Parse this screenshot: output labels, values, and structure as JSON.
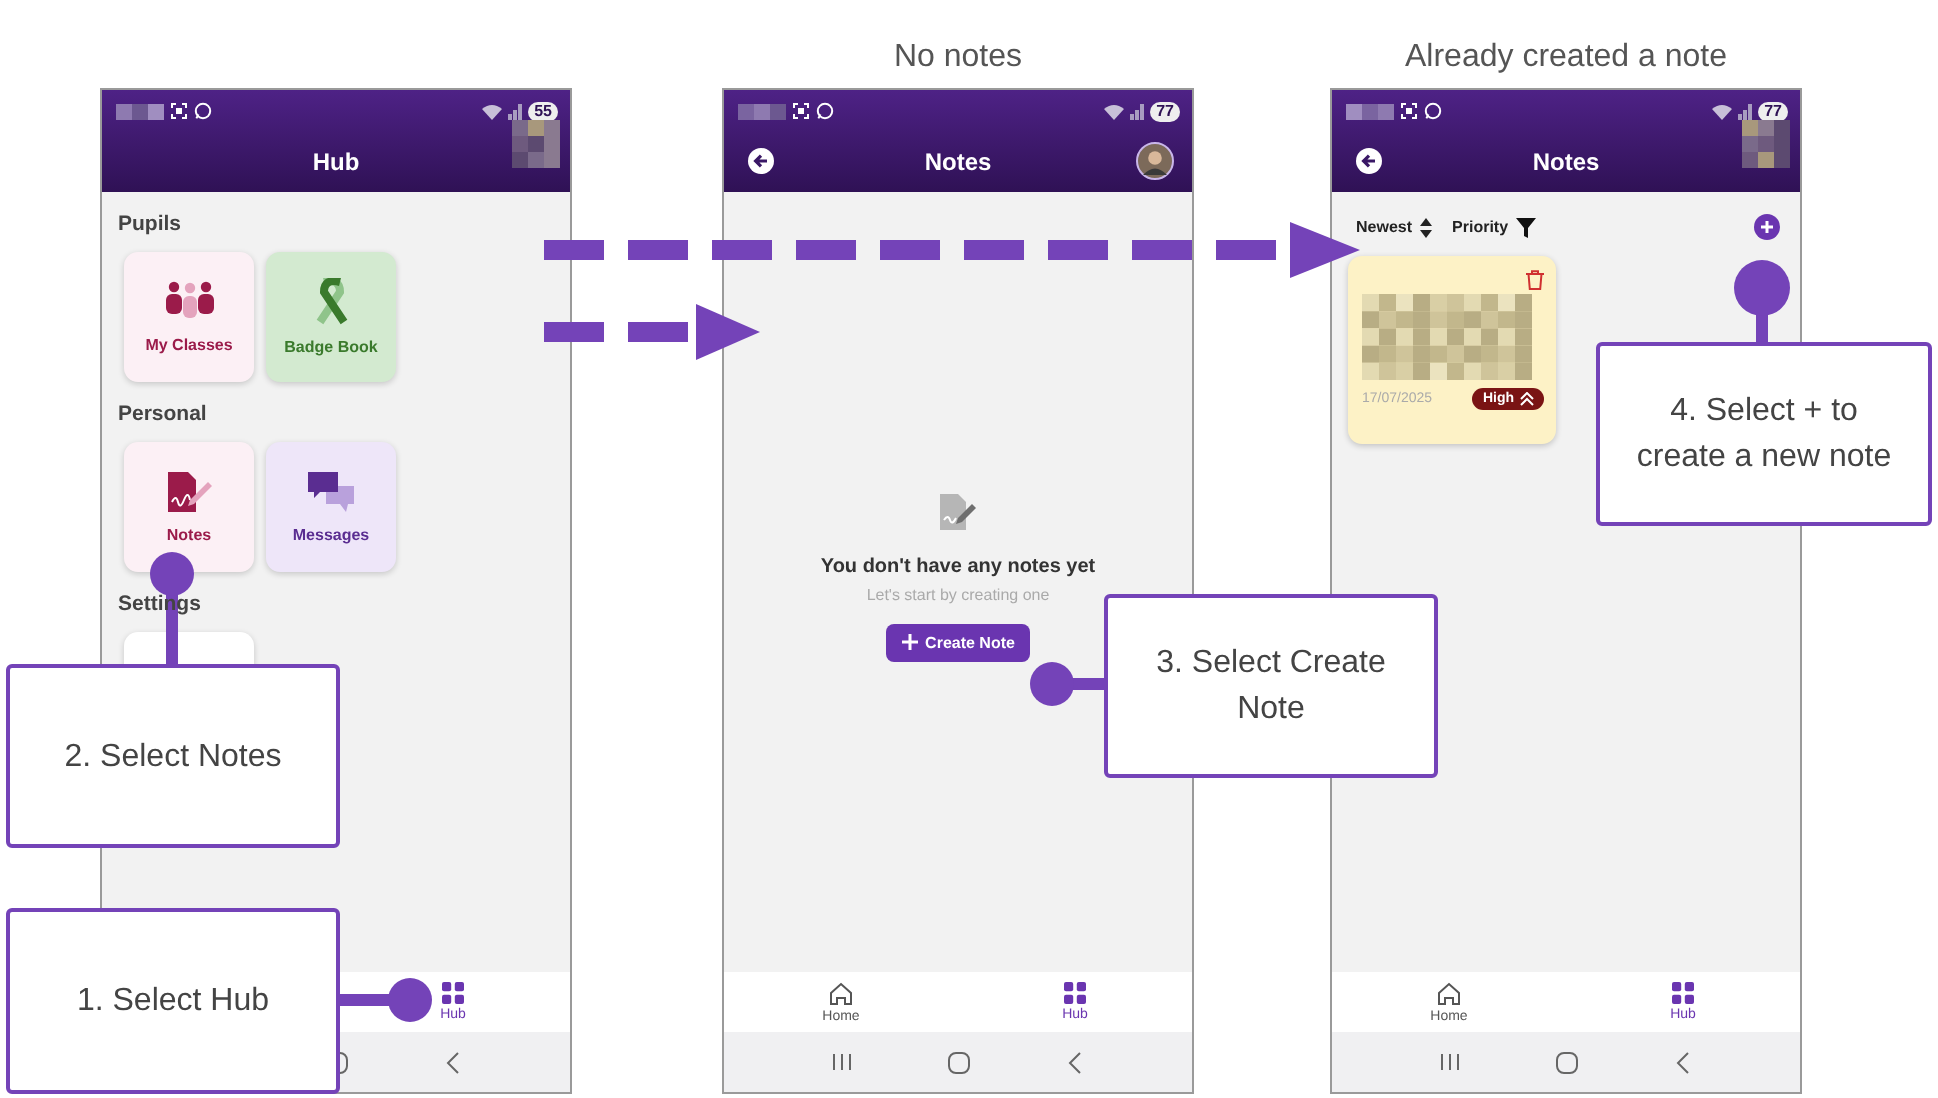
{
  "phones": [
    {
      "kind": "hub",
      "status_bar": {
        "battery": "55"
      },
      "header": {
        "title": "Hub",
        "back_button": false,
        "avatar": {
          "kind": "pixelated"
        }
      },
      "sections": [
        {
          "title": "Pupils",
          "tiles": [
            {
              "kind": "classes",
              "label": "My Classes"
            },
            {
              "kind": "badges",
              "label": "Badge Book"
            }
          ]
        },
        {
          "title": "Personal",
          "tiles": [
            {
              "kind": "notes",
              "label": "Notes"
            },
            {
              "kind": "messages",
              "label": "Messages"
            }
          ]
        },
        {
          "title": "Settings",
          "tiles": [
            {
              "kind": "blank"
            }
          ]
        }
      ],
      "bottom_nav": [
        {
          "kind": "hub",
          "label": "Hub",
          "selected": true
        }
      ],
      "system_nav": [
        {
          "kind": "home"
        },
        {
          "kind": "back"
        }
      ]
    },
    {
      "kind": "empty",
      "caption": "No notes",
      "status_bar": {
        "battery": "77"
      },
      "header": {
        "title": "Notes",
        "back_button": true
      },
      "empty_state": {
        "title": "You don't have any notes yet",
        "subtitle": "Let's start by creating one",
        "button": "Create Note"
      },
      "bottom_nav": [
        {
          "kind": "home",
          "label": "Home",
          "selected": false
        },
        {
          "kind": "hub",
          "label": "Hub",
          "selected": true
        }
      ],
      "system_nav": [
        {
          "kind": "recents"
        },
        {
          "kind": "home"
        },
        {
          "kind": "back"
        }
      ]
    },
    {
      "kind": "notes",
      "caption": "Already created a note",
      "status_bar": {
        "battery": "77"
      },
      "header": {
        "title": "Notes",
        "back_button": true,
        "avatar": {
          "kind": "pixelated"
        }
      },
      "toolbar": {
        "sort": "Newest",
        "filter": "Priority"
      },
      "notes": [
        {
          "date": "17/07/2025",
          "priority": "High"
        }
      ],
      "bottom_nav": [
        {
          "kind": "home",
          "label": "Home",
          "selected": false
        },
        {
          "kind": "hub",
          "label": "Hub",
          "selected": true
        }
      ],
      "system_nav": [
        {
          "kind": "recents"
        },
        {
          "kind": "home"
        },
        {
          "kind": "back"
        }
      ]
    }
  ],
  "callouts": [
    {
      "text": "1. Select Hub"
    },
    {
      "text": "2. Select Notes"
    },
    {
      "text": "3. Select Create Note"
    },
    {
      "text": "4. Select + to create a new note"
    }
  ]
}
